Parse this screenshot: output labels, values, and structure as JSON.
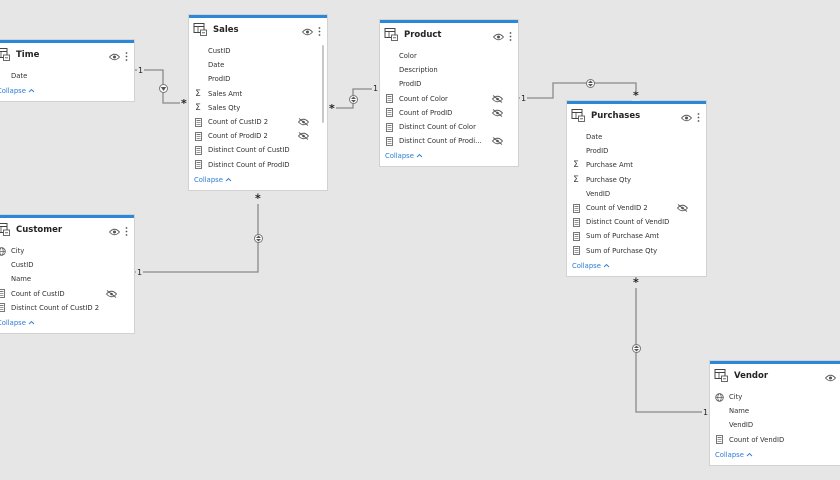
{
  "colors": {
    "accent": "#2b88d8",
    "canvas": "#e6e6e6",
    "link": "#8a8a8a",
    "collapse": "#2b7cd3"
  },
  "tables": [
    {
      "id": "time",
      "title": "Time",
      "fields": [
        {
          "name": "Date",
          "icon": "none"
        }
      ],
      "collapse_label": "Collapse"
    },
    {
      "id": "sales",
      "title": "Sales",
      "fields": [
        {
          "name": "CustID",
          "icon": "none"
        },
        {
          "name": "Date",
          "icon": "none"
        },
        {
          "name": "ProdID",
          "icon": "none"
        },
        {
          "name": "Sales Amt",
          "icon": "sigma-icon"
        },
        {
          "name": "Sales Qty",
          "icon": "sigma-icon"
        },
        {
          "name": "Count of CustID 2",
          "icon": "calculator-icon",
          "hidden": true
        },
        {
          "name": "Count of ProdID 2",
          "icon": "calculator-icon",
          "hidden": true
        },
        {
          "name": "Distinct Count of CustID",
          "icon": "calculator-icon"
        },
        {
          "name": "Distinct Count of ProdID",
          "icon": "calculator-icon"
        }
      ],
      "collapse_label": "Collapse"
    },
    {
      "id": "product",
      "title": "Product",
      "fields": [
        {
          "name": "Color",
          "icon": "none"
        },
        {
          "name": "Description",
          "icon": "none"
        },
        {
          "name": "ProdID",
          "icon": "none"
        },
        {
          "name": "Count of Color",
          "icon": "calculator-icon",
          "hidden": true
        },
        {
          "name": "Count of ProdID",
          "icon": "calculator-icon",
          "hidden": true
        },
        {
          "name": "Distinct Count of Color",
          "icon": "calculator-icon"
        },
        {
          "name": "Distinct Count of Prodi...",
          "icon": "calculator-icon",
          "hidden": true
        }
      ],
      "collapse_label": "Collapse"
    },
    {
      "id": "purchases",
      "title": "Purchases",
      "fields": [
        {
          "name": "Date",
          "icon": "none"
        },
        {
          "name": "ProdID",
          "icon": "none"
        },
        {
          "name": "Purchase Amt",
          "icon": "sigma-icon"
        },
        {
          "name": "Purchase Qty",
          "icon": "sigma-icon"
        },
        {
          "name": "VendID",
          "icon": "none"
        },
        {
          "name": "Count of VendID 2",
          "icon": "calculator-icon",
          "hidden": true
        },
        {
          "name": "Distinct Count of VendID",
          "icon": "calculator-icon"
        },
        {
          "name": "Sum of Purchase Amt",
          "icon": "calculator-icon"
        },
        {
          "name": "Sum of Purchase Qty",
          "icon": "calculator-icon"
        }
      ],
      "collapse_label": "Collapse"
    },
    {
      "id": "customer",
      "title": "Customer",
      "fields": [
        {
          "name": "City",
          "icon": "globe-icon"
        },
        {
          "name": "CustID",
          "icon": "none"
        },
        {
          "name": "Name",
          "icon": "none"
        },
        {
          "name": "Count of CustID",
          "icon": "calculator-icon",
          "hidden": true
        },
        {
          "name": "Distinct Count of CustID 2",
          "icon": "calculator-icon"
        }
      ],
      "collapse_label": "Collapse"
    },
    {
      "id": "vendor",
      "title": "Vendor",
      "fields": [
        {
          "name": "City",
          "icon": "globe-icon"
        },
        {
          "name": "Name",
          "icon": "none"
        },
        {
          "name": "VendID",
          "icon": "none"
        },
        {
          "name": "Count of VendID",
          "icon": "calculator-icon"
        }
      ],
      "collapse_label": "Collapse"
    }
  ],
  "relationships": [
    {
      "id": "time-sales",
      "from": "time",
      "to": "sales",
      "from_cardinality": "1",
      "to_cardinality": "*",
      "direction": "single"
    },
    {
      "id": "sales-product",
      "from": "sales",
      "to": "product",
      "from_cardinality": "*",
      "to_cardinality": "1",
      "direction": "both"
    },
    {
      "id": "customer-sales",
      "from": "customer",
      "to": "sales",
      "from_cardinality": "1",
      "to_cardinality": "*",
      "direction": "both"
    },
    {
      "id": "product-purchases",
      "from": "product",
      "to": "purchases",
      "from_cardinality": "1",
      "to_cardinality": "*",
      "direction": "both"
    },
    {
      "id": "vendor-purchases",
      "from": "vendor",
      "to": "purchases",
      "from_cardinality": "1",
      "to_cardinality": "*",
      "direction": "both"
    }
  ]
}
